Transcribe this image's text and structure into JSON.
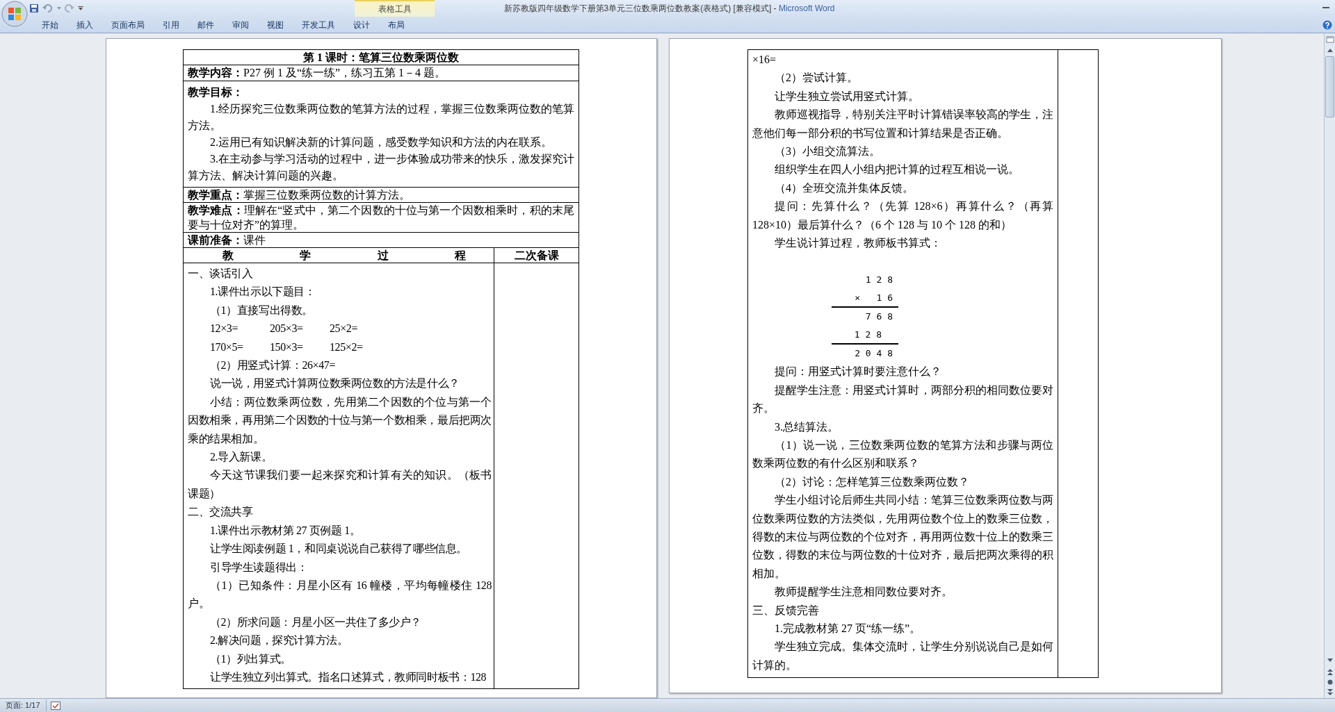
{
  "window": {
    "title": "新苏教版四年级数学下册第3单元三位数乘两位数教案(表格式) [兼容模式] -",
    "app_name": "Microsoft Word",
    "contextual_group": "表格工具"
  },
  "ribbon_tabs": [
    {
      "label": "开始",
      "selected": false
    },
    {
      "label": "插入",
      "selected": false
    },
    {
      "label": "页面布局",
      "selected": false
    },
    {
      "label": "引用",
      "selected": false
    },
    {
      "label": "邮件",
      "selected": false
    },
    {
      "label": "审阅",
      "selected": false
    },
    {
      "label": "视图",
      "selected": false
    },
    {
      "label": "开发工具",
      "selected": false
    },
    {
      "label": "设计",
      "selected": false
    },
    {
      "label": "布局",
      "selected": false
    }
  ],
  "left_page": {
    "title": "第 1 课时：笔算三位数乘两位数",
    "content": "**教学内容：**P27 例 1 及“练一练”，练习五第 1－4 题。",
    "objectives": {
      "heading": "教学目标：",
      "items": [
        "1.经历探究三位数乘两位数的笔算方法的过程，掌握三位数乘两位数的笔算方法。",
        "2.运用已有知识解决新的计算问题，感受数学知识和方法的内在联系。",
        "3.在主动参与学习活动的过程中，进一步体验成功带来的快乐，激发探究计算方法、解决计算问题的兴趣。"
      ]
    },
    "key_point": "**教学重点：**掌握三位数乘两位数的计算方法。",
    "difficulty": "**教学难点：**理解在“竖式中，第二个因数的十位与第一个因数相乘时，积的末尾要与十位对齐”的算理。",
    "preparation": "**课前准备：**课件",
    "process_heading": "教学过程",
    "revision_heading": "二次备课",
    "paragraphs": [
      {
        "kind": "flush",
        "text": "一、谈话引入"
      },
      {
        "kind": "indent",
        "text": "1.课件出示以下题目："
      },
      {
        "kind": "indent",
        "text": "（1）直接写出得数。"
      },
      {
        "kind": "equations",
        "cells": [
          "12×3=",
          "205×3=",
          "25×2="
        ]
      },
      {
        "kind": "equations",
        "cells": [
          "170×5=",
          "150×3=",
          "125×2="
        ]
      },
      {
        "kind": "indent",
        "text": "（2）用竖式计算：26×47="
      },
      {
        "kind": "indent",
        "text": "说一说，用竖式计算两位数乘两位数的方法是什么？"
      },
      {
        "kind": "indent",
        "text": "小结：两位数乘两位数，先用第二个因数的个位与第一个因数相乘，再用第二个因数的十位与第一个数相乘，最后把两次乘的结果相加。"
      },
      {
        "kind": "indent",
        "text": "2.导入新课。"
      },
      {
        "kind": "indent",
        "text": "今天这节课我们要一起来探究和计算有关的知识。（板书课题）"
      },
      {
        "kind": "flush",
        "text": "二、交流共享"
      },
      {
        "kind": "indent",
        "text": "1.课件出示教材第 27 页例题 1。"
      },
      {
        "kind": "indent",
        "text": "让学生阅读例题 1，和同桌说说自己获得了哪些信息。"
      },
      {
        "kind": "indent",
        "text": "引导学生读题得出："
      },
      {
        "kind": "indent",
        "text": "（1）已知条件：月星小区有 16 幢楼，平均每幢楼住 128 户。"
      },
      {
        "kind": "indent",
        "text": "（2）所求问题：月星小区一共住了多少户？"
      },
      {
        "kind": "indent",
        "text": "2.解决问题，探究计算方法。"
      },
      {
        "kind": "indent",
        "text": "（1）列出算式。"
      },
      {
        "kind": "indent",
        "text": "让学生独立列出算式。指名口述算式，教师同时板书：128"
      }
    ]
  },
  "right_page": {
    "paragraphs": [
      {
        "kind": "flush",
        "text": "×16="
      },
      {
        "kind": "indent",
        "text": "（2）尝试计算。"
      },
      {
        "kind": "indent",
        "text": "让学生独立尝试用竖式计算。"
      },
      {
        "kind": "indent",
        "text": "教师巡视指导，特别关注平时计算错误率较高的学生，注意他们每一部分积的书写位置和计算结果是否正确。"
      },
      {
        "kind": "indent",
        "text": "（3）小组交流算法。"
      },
      {
        "kind": "indent",
        "text": "组织学生在四人小组内把计算的过程互相说一说。"
      },
      {
        "kind": "indent",
        "text": "（4）全班交流并集体反馈。"
      },
      {
        "kind": "indent",
        "text": "提问：先算什么？（先算 128×6）再算什么？（再算 128×10）最后算什么？（6 个 128 与 10 个 128 的和）"
      },
      {
        "kind": "indent",
        "text": "学生说计算过程，教师板书算式："
      },
      {
        "kind": "blank"
      },
      {
        "kind": "calc",
        "lines": [
          {
            "text": "1 2 8",
            "rule_below": false,
            "shifted": false
          },
          {
            "text": "×   1 6",
            "rule_below": true,
            "shifted": false
          },
          {
            "text": "7 6 8",
            "rule_below": false,
            "shifted": false
          },
          {
            "text": "1 2 8",
            "rule_below": true,
            "shifted": true
          },
          {
            "text": "2 0 4 8",
            "rule_below": false,
            "shifted": false
          }
        ]
      },
      {
        "kind": "indent",
        "text": "提问：用竖式计算时要注意什么？"
      },
      {
        "kind": "indent",
        "text": "提醒学生注意：用竖式计算时，两部分积的相同数位要对齐。"
      },
      {
        "kind": "indent",
        "text": "3.总结算法。"
      },
      {
        "kind": "indent",
        "text": "（1）说一说，三位数乘两位数的笔算方法和步骤与两位数乘两位数的有什么区别和联系？"
      },
      {
        "kind": "indent",
        "text": "（2）讨论：怎样笔算三位数乘两位数？"
      },
      {
        "kind": "indent",
        "text": "学生小组讨论后师生共同小结：笔算三位数乘两位数与两位数乘两位数的方法类似，先用两位数个位上的数乘三位数，得数的末位与两位数的个位对齐，再用两位数十位上的数乘三位数，得数的末位与两位数的十位对齐，最后把两次乘得的积相加。"
      },
      {
        "kind": "indent",
        "text": "教师提醒学生注意相同数位要对齐。"
      },
      {
        "kind": "flush",
        "text": "三、反馈完善"
      },
      {
        "kind": "indent",
        "text": "1.完成教材第 27 页“练一练”。"
      },
      {
        "kind": "indent",
        "text": "学生独立完成。集体交流时，让学生分别说说自己是如何计算的。"
      }
    ]
  },
  "status_bar": {
    "page": "页面: 1/17"
  }
}
